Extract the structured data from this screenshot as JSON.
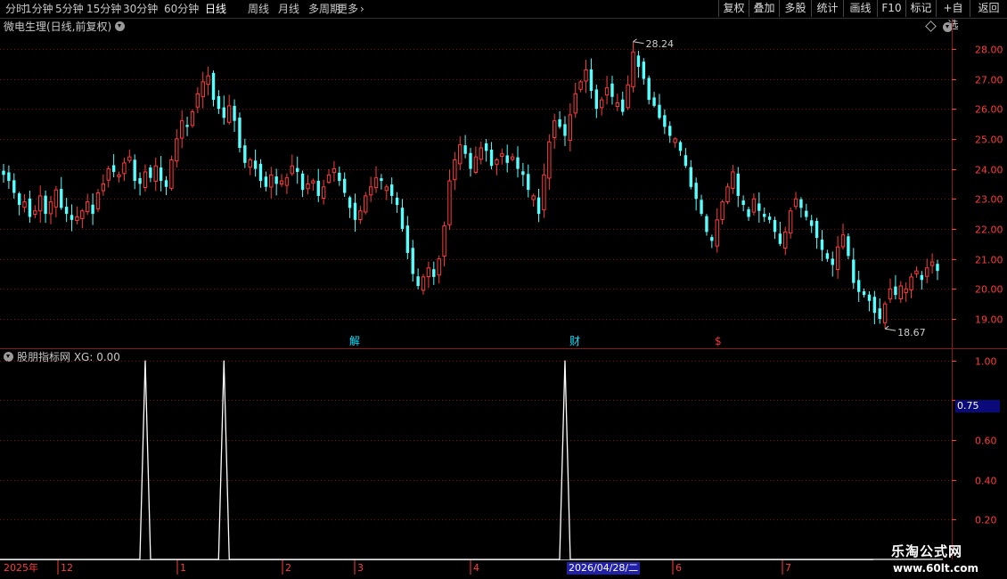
{
  "topbar": {
    "periods": [
      "分时",
      "1分钟",
      "5分钟",
      "15分钟",
      "30分钟",
      "60分钟",
      "日线",
      "周线",
      "月线",
      "多周期",
      "更多"
    ],
    "active_period": "日线",
    "buttons": [
      "复权",
      "叠加",
      "多股",
      "统计",
      "画线",
      "F10",
      "标记",
      "+自选",
      "返回"
    ]
  },
  "main_panel": {
    "title": "微电生理(日线,前复权)",
    "high_label": "28.24",
    "low_label": "18.67",
    "events": [
      {
        "text": "解",
        "color": "#00e0ff"
      },
      {
        "text": "财",
        "color": "#00e0ff"
      },
      {
        "text": "$",
        "color": "#ff3030"
      }
    ]
  },
  "sub_panel": {
    "title": "股朋指标网 XG: 0.00",
    "current_value": "0.75"
  },
  "x_axis": {
    "labels": [
      "2025年",
      "12",
      "1",
      "2",
      "3",
      "4",
      "6",
      "7"
    ],
    "cursor_date": "2026/04/28/二"
  },
  "watermark": {
    "line1": "乐淘公式网",
    "line2": "www.60lt.com"
  },
  "colors": {
    "up": "#ff3b3b",
    "down": "#54ffff",
    "grid": "#7a1010",
    "indicator": "#ffffff"
  },
  "chart_data": [
    {
      "type": "candlestick",
      "title": "微电生理(日线,前复权)",
      "y_axis": {
        "ticks": [
          19.0,
          20.0,
          21.0,
          22.0,
          23.0,
          24.0,
          25.0,
          26.0,
          27.0,
          28.0
        ],
        "range": [
          18.2,
          28.5
        ]
      },
      "max": 28.24,
      "min": 18.67,
      "closes": [
        23.8,
        23.6,
        23.2,
        22.8,
        22.9,
        22.4,
        22.6,
        23.1,
        22.5,
        22.9,
        23.3,
        22.7,
        22.5,
        22.3,
        22.4,
        22.6,
        22.9,
        22.5,
        23.2,
        23.5,
        24.0,
        23.9,
        23.8,
        24.2,
        24.4,
        23.6,
        23.5,
        23.9,
        23.7,
        24.1,
        23.6,
        23.4,
        24.3,
        25.0,
        25.6,
        25.4,
        25.9,
        26.5,
        26.9,
        27.1,
        26.3,
        26.0,
        25.7,
        26.1,
        25.6,
        24.7,
        24.2,
        24.3,
        24.0,
        23.6,
        23.4,
        23.8,
        23.5,
        23.6,
        23.7,
        24.1,
        23.9,
        23.3,
        23.5,
        23.6,
        23.1,
        23.4,
        23.8,
        24.0,
        23.6,
        23.2,
        22.7,
        22.3,
        22.6,
        23.1,
        23.4,
        23.7,
        23.6,
        23.4,
        23.1,
        22.8,
        22.0,
        21.2,
        20.5,
        20.1,
        20.4,
        20.7,
        20.4,
        21.0,
        22.1,
        23.6,
        24.3,
        24.8,
        24.5,
        24.0,
        24.4,
        24.7,
        24.6,
        24.1,
        24.3,
        24.5,
        24.2,
        24.4,
        24.0,
        23.8,
        23.3,
        23.1,
        22.5,
        23.8,
        24.9,
        25.6,
        25.4,
        25.1,
        25.8,
        26.5,
        26.9,
        27.3,
        26.6,
        26.0,
        26.3,
        26.7,
        26.4,
        26.2,
        25.9,
        26.8,
        27.9,
        27.4,
        27.0,
        26.3,
        26.1,
        25.7,
        25.4,
        25.1,
        25.0,
        24.6,
        24.1,
        23.4,
        23.0,
        22.5,
        21.9,
        21.6,
        22.3,
        22.9,
        23.4,
        23.9,
        23.1,
        22.8,
        22.4,
        23.0,
        22.6,
        22.4,
        22.3,
        21.9,
        21.5,
        21.9,
        22.6,
        23.0,
        22.7,
        22.4,
        22.1,
        21.7,
        21.3,
        21.0,
        20.8,
        21.4,
        21.8,
        21.1,
        20.2,
        19.9,
        19.8,
        19.6,
        19.2,
        19.0,
        19.5,
        20.0,
        19.8,
        20.1,
        20.0,
        20.4,
        20.6,
        20.3,
        20.7,
        20.9,
        20.6
      ]
    },
    {
      "type": "line",
      "title": "股朋指标网 XG: 0.00",
      "series": [
        {
          "name": "XG",
          "pulses_at_candle": [
            27,
            42,
            107
          ]
        }
      ],
      "y_axis": {
        "ticks": [
          0.2,
          0.4,
          0.6,
          0.8,
          1.0
        ],
        "range": [
          0,
          1.03
        ]
      }
    }
  ]
}
